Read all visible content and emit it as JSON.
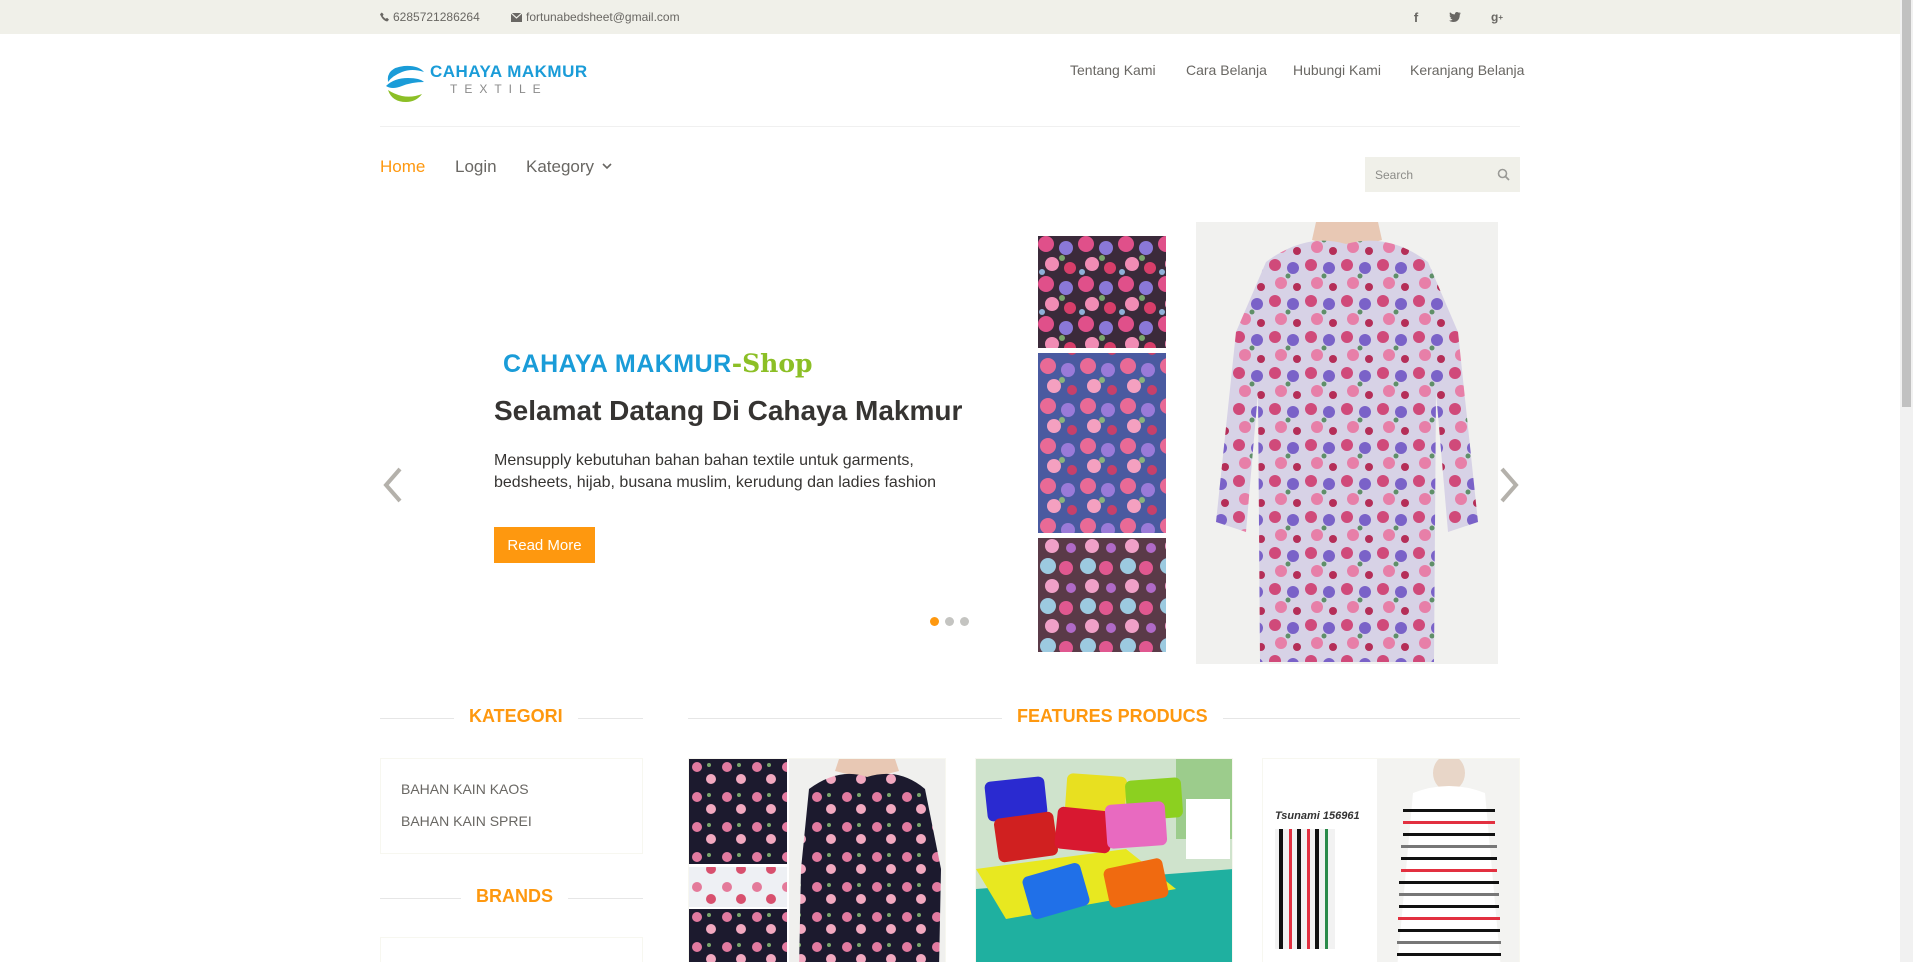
{
  "topbar": {
    "phone": "6285721286264",
    "email": "fortunabedsheet@gmail.com",
    "social": [
      "facebook-icon",
      "twitter-icon",
      "google-plus-icon"
    ]
  },
  "logo": {
    "line1": "CAHAYA MAKMUR",
    "line2": "TEXTILE"
  },
  "header_nav": [
    "Tentang Kami",
    "Cara Belanja",
    "Hubungi Kami",
    "Keranjang Belanja"
  ],
  "main_nav": {
    "home": "Home",
    "login": "Login",
    "category": "Kategory"
  },
  "search": {
    "placeholder": "Search"
  },
  "slider": {
    "brand_main": "CAHAYA MAKMUR",
    "brand_suffix": "-Shop",
    "heading": "Selamat Datang Di Cahaya Makmur",
    "text": "Mensupply kebutuhan bahan bahan textile untuk garments, bedsheets, hijab, busana muslim, kerudung dan ladies fashion",
    "button": "Read More",
    "active_slide": 1,
    "slide_count": 3
  },
  "sidebar": {
    "category_title": "KATEGORI",
    "categories": [
      "BAHAN KAIN KAOS",
      "BAHAN KAIN SPREI"
    ],
    "brands_title": "BRANDS"
  },
  "features": {
    "title": "FEATURES PRODUCS",
    "product3_label": "Tsunami 156961"
  },
  "colors": {
    "accent": "#fe980f",
    "brand_blue": "#1a9cd8",
    "brand_green": "#8cbf26"
  }
}
